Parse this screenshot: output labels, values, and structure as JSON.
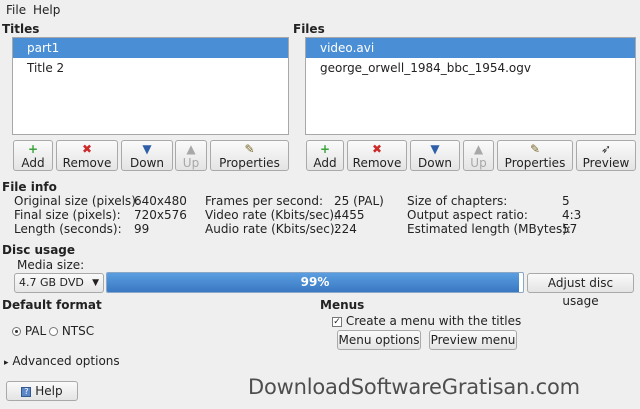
{
  "menu": {
    "file": "File",
    "help": "Help"
  },
  "titles": {
    "heading": "Titles",
    "items": [
      {
        "label": "part1",
        "selected": true
      },
      {
        "label": "Title 2",
        "selected": false
      }
    ],
    "buttons": {
      "add": "Add",
      "remove": "Remove",
      "down": "Down",
      "up": "Up",
      "properties": "Properties"
    }
  },
  "files": {
    "heading": "Files",
    "items": [
      {
        "label": "video.avi",
        "selected": true
      },
      {
        "label": "george_orwell_1984_bbc_1954.ogv",
        "selected": false
      }
    ],
    "buttons": {
      "add": "Add",
      "remove": "Remove",
      "down": "Down",
      "up": "Up",
      "properties": "Properties",
      "preview": "Preview"
    }
  },
  "file_info": {
    "heading": "File info",
    "col1": [
      {
        "label": "Original size (pixels):",
        "value": "640x480"
      },
      {
        "label": "Final size (pixels):",
        "value": "720x576"
      },
      {
        "label": "Length (seconds):",
        "value": "99"
      }
    ],
    "col2": [
      {
        "label": "Frames per second:",
        "value": "25 (PAL)"
      },
      {
        "label": "Video rate (Kbits/sec):",
        "value": "4455"
      },
      {
        "label": "Audio rate (Kbits/sec):",
        "value": "224"
      }
    ],
    "col3": [
      {
        "label": "Size of chapters:",
        "value": "5"
      },
      {
        "label": "Output aspect ratio:",
        "value": "4:3"
      },
      {
        "label": "Estimated length (MBytes):",
        "value": "57"
      }
    ]
  },
  "disc_usage": {
    "heading": "Disc usage",
    "media_label": "Media size:",
    "media_value": "4.7 GB DVD",
    "progress_text": "99%",
    "progress_fraction": 0.99,
    "adjust_button": "Adjust disc usage"
  },
  "default_format": {
    "heading": "Default format",
    "options": [
      "PAL",
      "NTSC"
    ],
    "selected": "PAL"
  },
  "menus": {
    "heading": "Menus",
    "create_menu_label": "Create a menu with the titles",
    "create_menu_checked": true,
    "options_button": "Menu options",
    "preview_button": "Preview menu"
  },
  "advanced": {
    "label": "Advanced options"
  },
  "footer": {
    "help_button": "Help"
  },
  "watermark": "DownloadSoftwareGratisan.com",
  "colors": {
    "selection": "#4a8fd6",
    "progress": "#3a78c2",
    "window": "#efefef"
  }
}
